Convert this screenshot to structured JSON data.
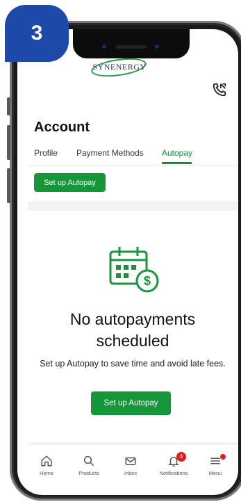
{
  "step": {
    "number": "3"
  },
  "header": {
    "logo_text": "SYNENERGY"
  },
  "page": {
    "title": "Account"
  },
  "tabs": [
    {
      "label": "Profile",
      "active": false
    },
    {
      "label": "Payment Methods",
      "active": false
    },
    {
      "label": "Autopay",
      "active": true
    }
  ],
  "actions": {
    "setup_top_label": "Set up Autopay"
  },
  "empty_state": {
    "title_line1": "No autopayments",
    "title_line2": "scheduled",
    "description": "Set up Autopay to save time and avoid late fees.",
    "button_label": "Set up Autopay"
  },
  "bottom_nav": [
    {
      "label": "Home",
      "icon": "home-icon"
    },
    {
      "label": "Products",
      "icon": "search-icon"
    },
    {
      "label": "Inbox",
      "icon": "mail-icon"
    },
    {
      "label": "Notifications",
      "icon": "bell-icon",
      "badge": "4"
    },
    {
      "label": "Menu",
      "icon": "menu-icon"
    }
  ],
  "colors": {
    "brand_green": "#159638",
    "badge_blue": "#1d4aa9",
    "alert_red": "#e31f1f"
  }
}
